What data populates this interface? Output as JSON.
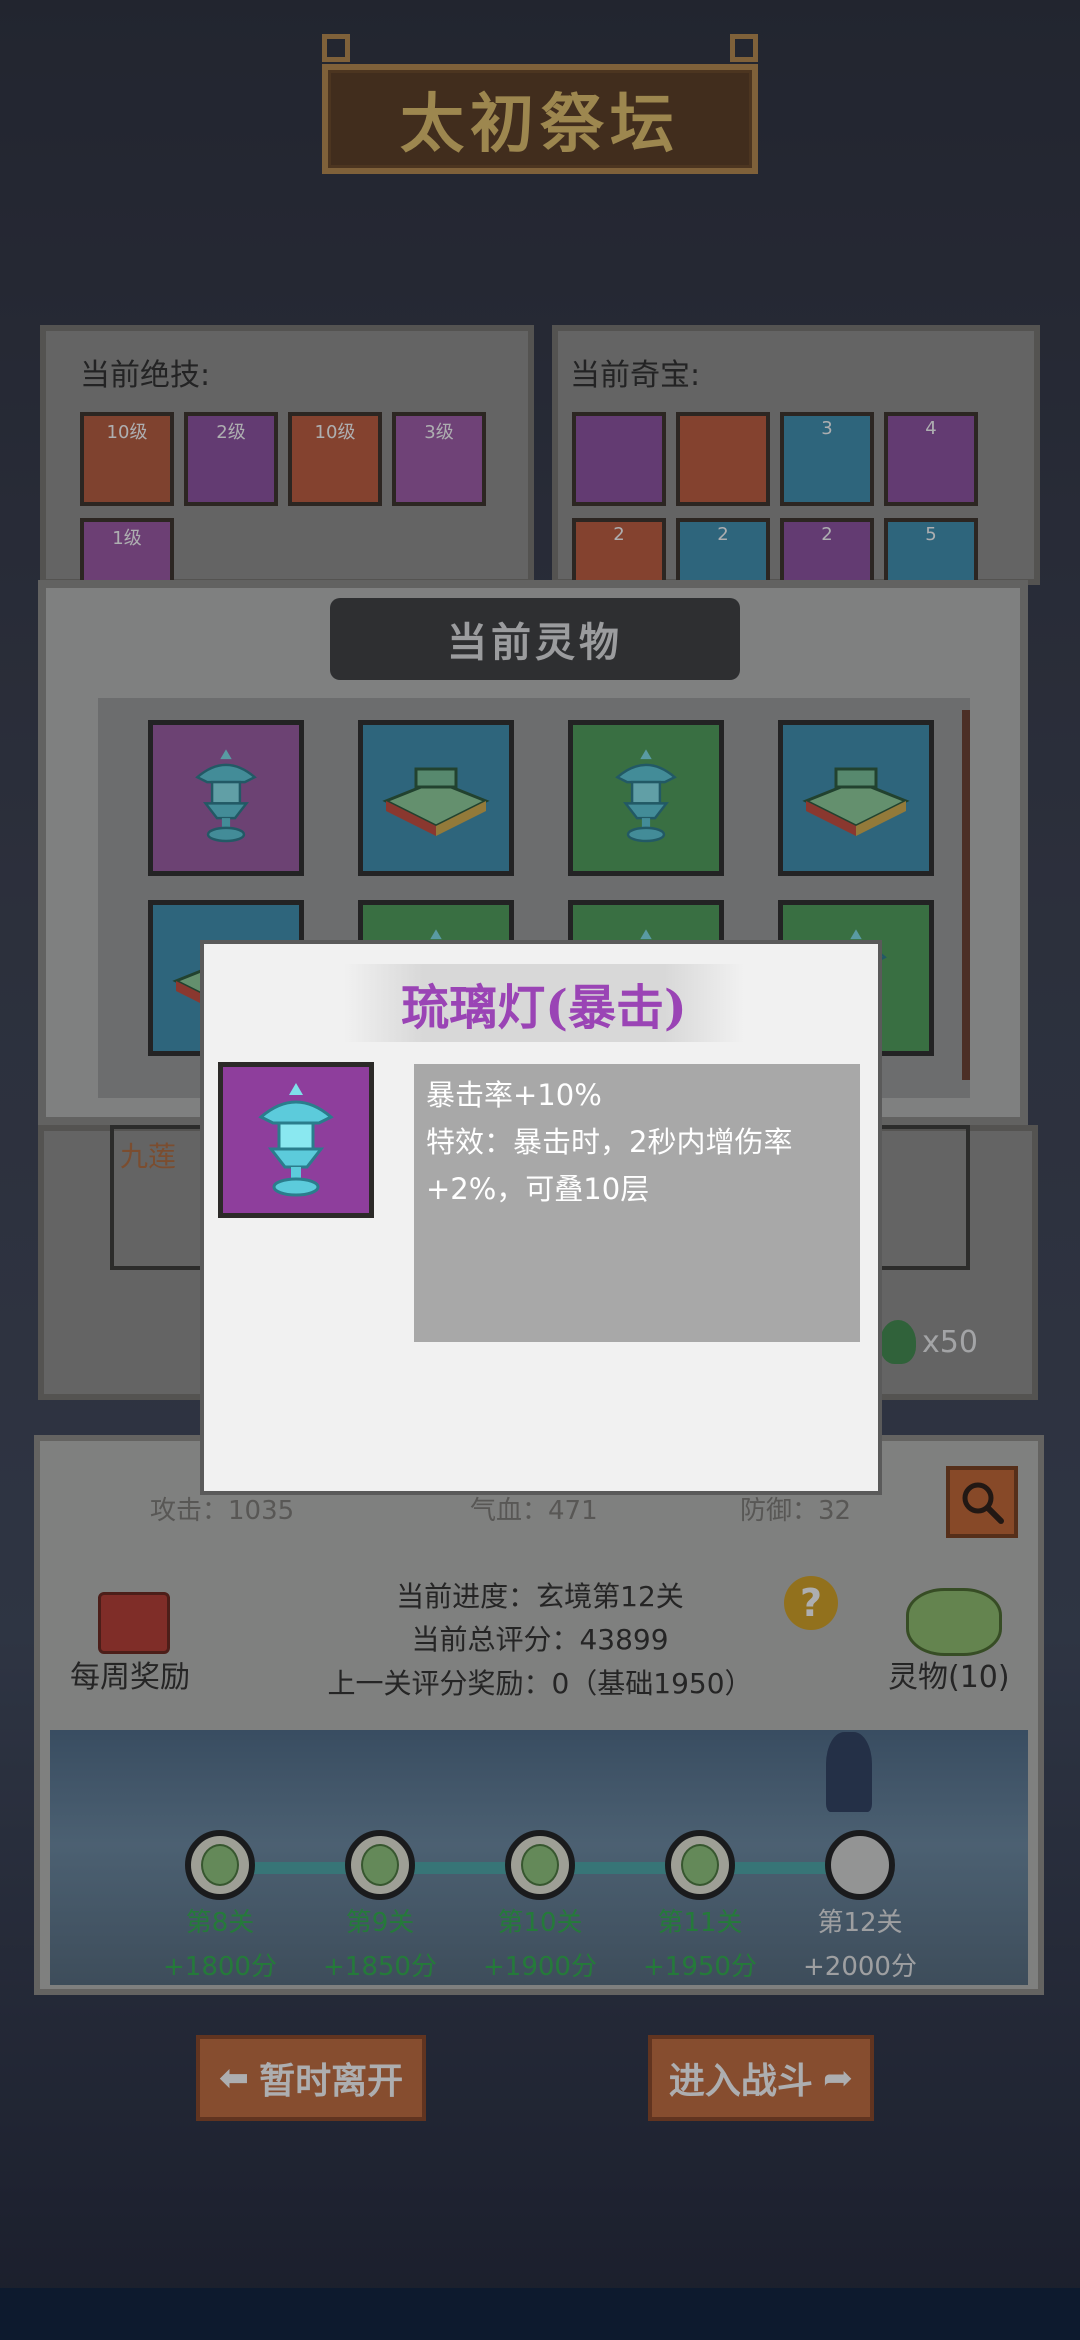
{
  "title": "太初祭坛",
  "skills": {
    "label": "当前绝技:",
    "slots": [
      {
        "level": "10级",
        "color": "#b9593a"
      },
      {
        "level": "2级",
        "color": "#8e4fa0"
      },
      {
        "level": "10级",
        "color": "#c0593a"
      },
      {
        "level": "3级",
        "color": "#a05aa8"
      },
      {
        "level": "1级",
        "color": "#9c55a3"
      }
    ]
  },
  "treasures": {
    "label": "当前奇宝:",
    "slots": [
      {
        "count": "",
        "color": "#8e4fa0"
      },
      {
        "count": "",
        "color": "#c0593a"
      },
      {
        "count": "3",
        "color": "#3d8fb0"
      },
      {
        "count": "4",
        "color": "#8e4fa0"
      },
      {
        "count": "2",
        "color": "#c0593a"
      },
      {
        "count": "2",
        "color": "#3d8fb0"
      },
      {
        "count": "2",
        "color": "#8e4fa0"
      },
      {
        "count": "5",
        "color": "#3d8fb0"
      }
    ]
  },
  "spirit_panel": {
    "header": "当前灵物",
    "items": [
      {
        "type": "lamp-icon",
        "color": "purple"
      },
      {
        "type": "scroll-icon",
        "color": "blue"
      },
      {
        "type": "lamp-icon",
        "color": "green"
      },
      {
        "type": "scroll-icon",
        "color": "blue"
      },
      {
        "type": "scroll-icon",
        "color": "blue"
      },
      {
        "type": "lamp-icon",
        "color": "green"
      },
      {
        "type": "lamp-icon",
        "color": "green"
      },
      {
        "type": "lamp-icon",
        "color": "green"
      }
    ]
  },
  "partial": {
    "nine_lotus": "九莲",
    "count": "x50"
  },
  "tooltip": {
    "title": "琉璃灯(暴击)",
    "lines": [
      "暴击率+10%",
      "特效：暴击时，2秒内增伤率",
      "+2%，可叠10层"
    ]
  },
  "stats": {
    "attack": "攻击：1035",
    "hp": "气血：471",
    "defense": "防御：32"
  },
  "progress": {
    "current": "当前进度：玄境第12关",
    "total_score": "当前总评分：43899",
    "last_reward": "上一关评分奖励：0（基础1950）"
  },
  "weekly_reward": "每周奖励",
  "spirits_link": "灵物(10)",
  "stages": [
    {
      "name": "第8关",
      "score": "+1800分",
      "done": true
    },
    {
      "name": "第9关",
      "score": "+1850分",
      "done": true
    },
    {
      "name": "第10关",
      "score": "+1900分",
      "done": true
    },
    {
      "name": "第11关",
      "score": "+1950分",
      "done": true
    },
    {
      "name": "第12关",
      "score": "+2000分",
      "done": false
    }
  ],
  "buttons": {
    "leave": "暂时离开",
    "battle": "进入战斗"
  },
  "colors": {
    "accent_orange": "#c36a3a",
    "done_green": "#2fb04a",
    "title_gold": "#e7c36b",
    "spirit_purple": "#9a44b5"
  }
}
